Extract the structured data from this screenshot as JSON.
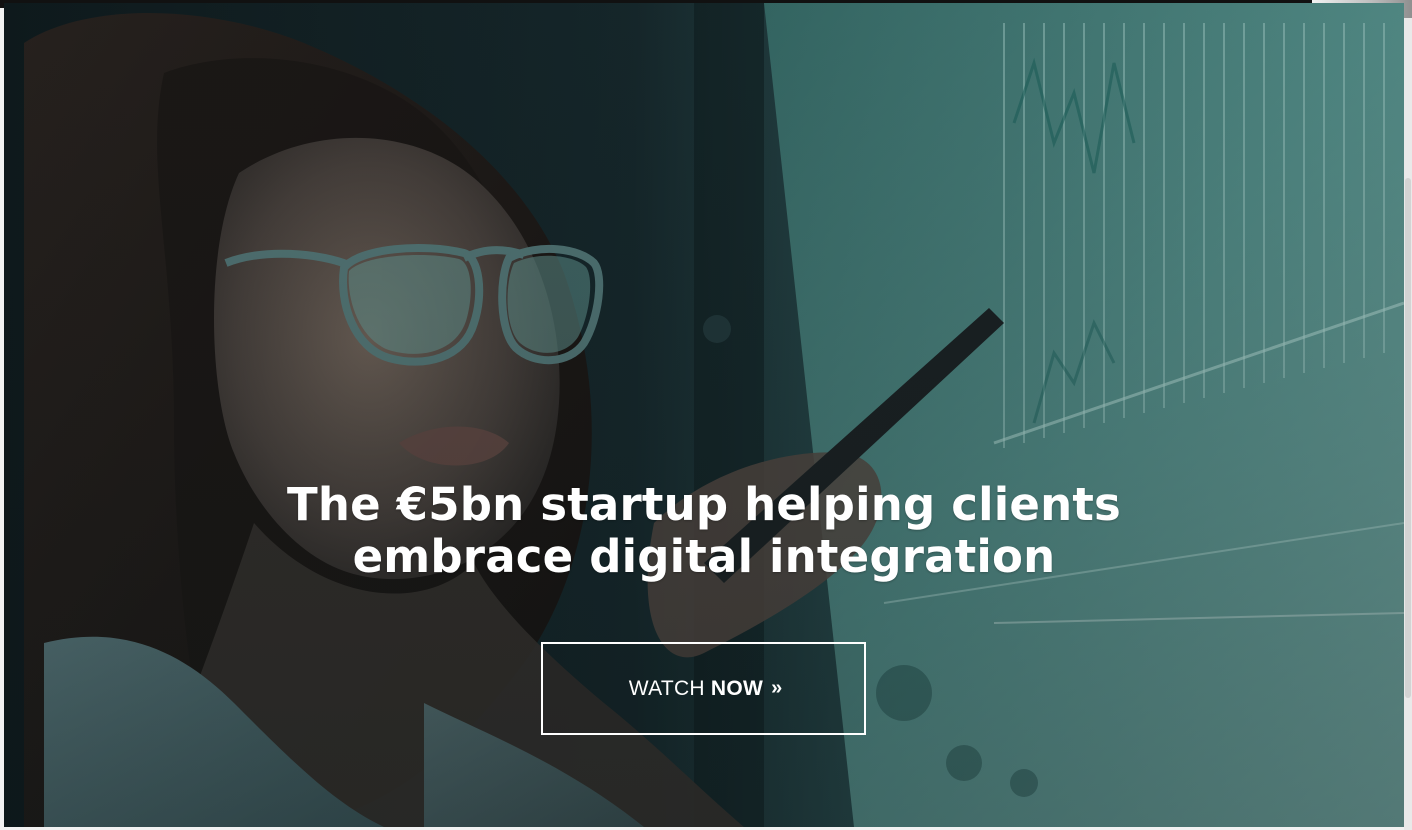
{
  "hero": {
    "headline_line1": "The €5bn startup helping clients",
    "headline_line2": "embrace digital integration",
    "cta": {
      "label_light": "WATCH",
      "label_bold": "NOW",
      "chevron": "»"
    }
  },
  "colors": {
    "overlay": "#0d1c1f",
    "teal_accent": "#2f8f8a",
    "text": "#ffffff"
  }
}
